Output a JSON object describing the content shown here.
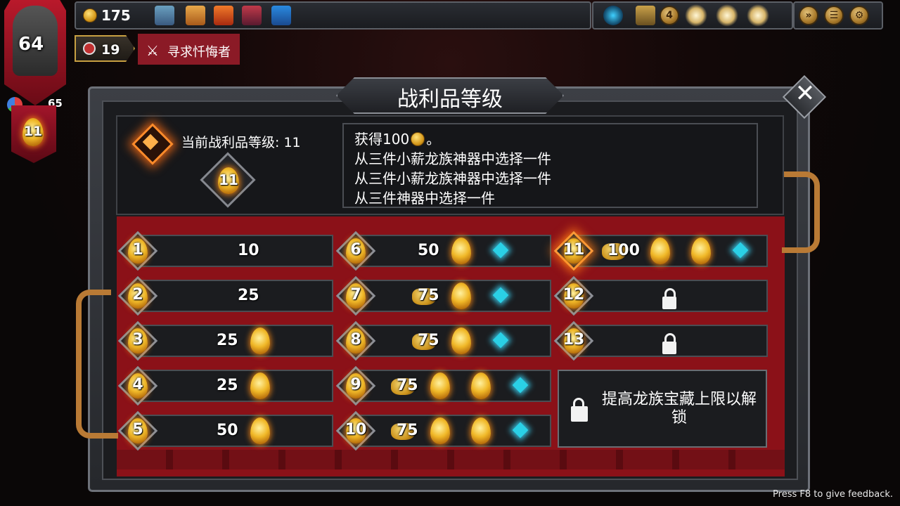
{
  "hud": {
    "gold": "175",
    "hp": "64",
    "armor": "65",
    "loot_level_badge": "11",
    "keys": "19",
    "quest": "寻求忏悔者",
    "relic_count": "4"
  },
  "panel": {
    "title": "战利品等级",
    "current_label": "当前战利品等级:  11",
    "current_level": "11",
    "rewards_desc": [
      "获得100",
      "。",
      "从三件小薪龙族神器中选择一件",
      "从三件小薪龙族神器中选择一件",
      "从三件神器中选择一件"
    ],
    "unlock_text": "提高龙族宝藏上限以解锁"
  },
  "levels": [
    {
      "level": "1",
      "gold": "10"
    },
    {
      "level": "2",
      "gold": "25"
    },
    {
      "level": "3",
      "gold": "25"
    },
    {
      "level": "4",
      "gold": "25"
    },
    {
      "level": "5",
      "gold": "50"
    },
    {
      "level": "6",
      "gold": "50"
    },
    {
      "level": "7",
      "gold": "75"
    },
    {
      "level": "8",
      "gold": "75"
    },
    {
      "level": "9",
      "gold": "75"
    },
    {
      "level": "10",
      "gold": "75"
    },
    {
      "level": "11",
      "gold": "100"
    },
    {
      "level": "12",
      "gold": ""
    },
    {
      "level": "13",
      "gold": ""
    }
  ],
  "feedback": "Press F8 to give feedback.",
  "colors": {
    "accent": "#ff8b2a",
    "red": "#8b1118",
    "panel": "#2a2c30"
  }
}
